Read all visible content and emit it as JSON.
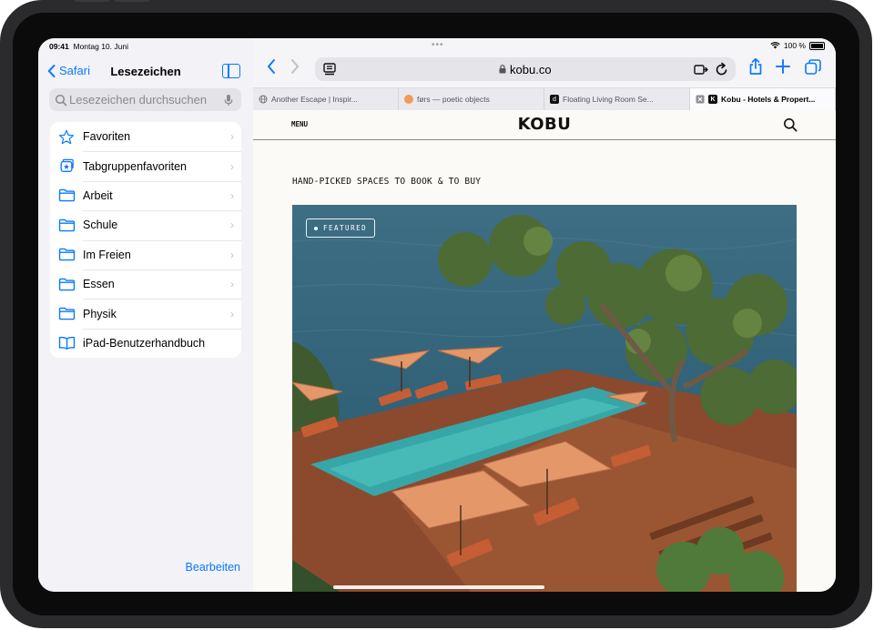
{
  "status": {
    "time": "09:41",
    "date": "Montag 10. Juni",
    "battery": "100 %"
  },
  "sidebar": {
    "back_label": "Safari",
    "title": "Lesezeichen",
    "search_placeholder": "Lesezeichen durchsuchen",
    "items": [
      {
        "label": "Favoriten",
        "icon": "star-icon"
      },
      {
        "label": "Tabgruppenfavoriten",
        "icon": "tab-group-favorites-icon"
      },
      {
        "label": "Arbeit",
        "icon": "folder-icon"
      },
      {
        "label": "Schule",
        "icon": "folder-icon"
      },
      {
        "label": "Im Freien",
        "icon": "folder-icon"
      },
      {
        "label": "Essen",
        "icon": "folder-icon"
      },
      {
        "label": "Physik",
        "icon": "folder-icon"
      },
      {
        "label": "iPad-Benutzerhandbuch",
        "icon": "book-icon"
      }
    ],
    "edit_label": "Bearbeiten"
  },
  "browser": {
    "url": "kobu.co",
    "accent": "#0a7aff",
    "tabs": [
      {
        "label": "Another Escape | Inspir...",
        "favicon": "globe-icon",
        "active": false
      },
      {
        "label": "førs — poetic objects",
        "favicon": "orange-dot-icon",
        "active": false
      },
      {
        "label": "Floating Living Room Se...",
        "favicon": "d-letter-icon",
        "active": false
      },
      {
        "label": "Kobu - Hotels & Propert...",
        "favicon": "kobu-icon",
        "active": true
      }
    ]
  },
  "page": {
    "menu_label": "MENU",
    "logo": "KOBU",
    "tagline": "HAND-PICKED SPACES TO BOOK & TO BUY",
    "featured_label": "FEATURED"
  }
}
